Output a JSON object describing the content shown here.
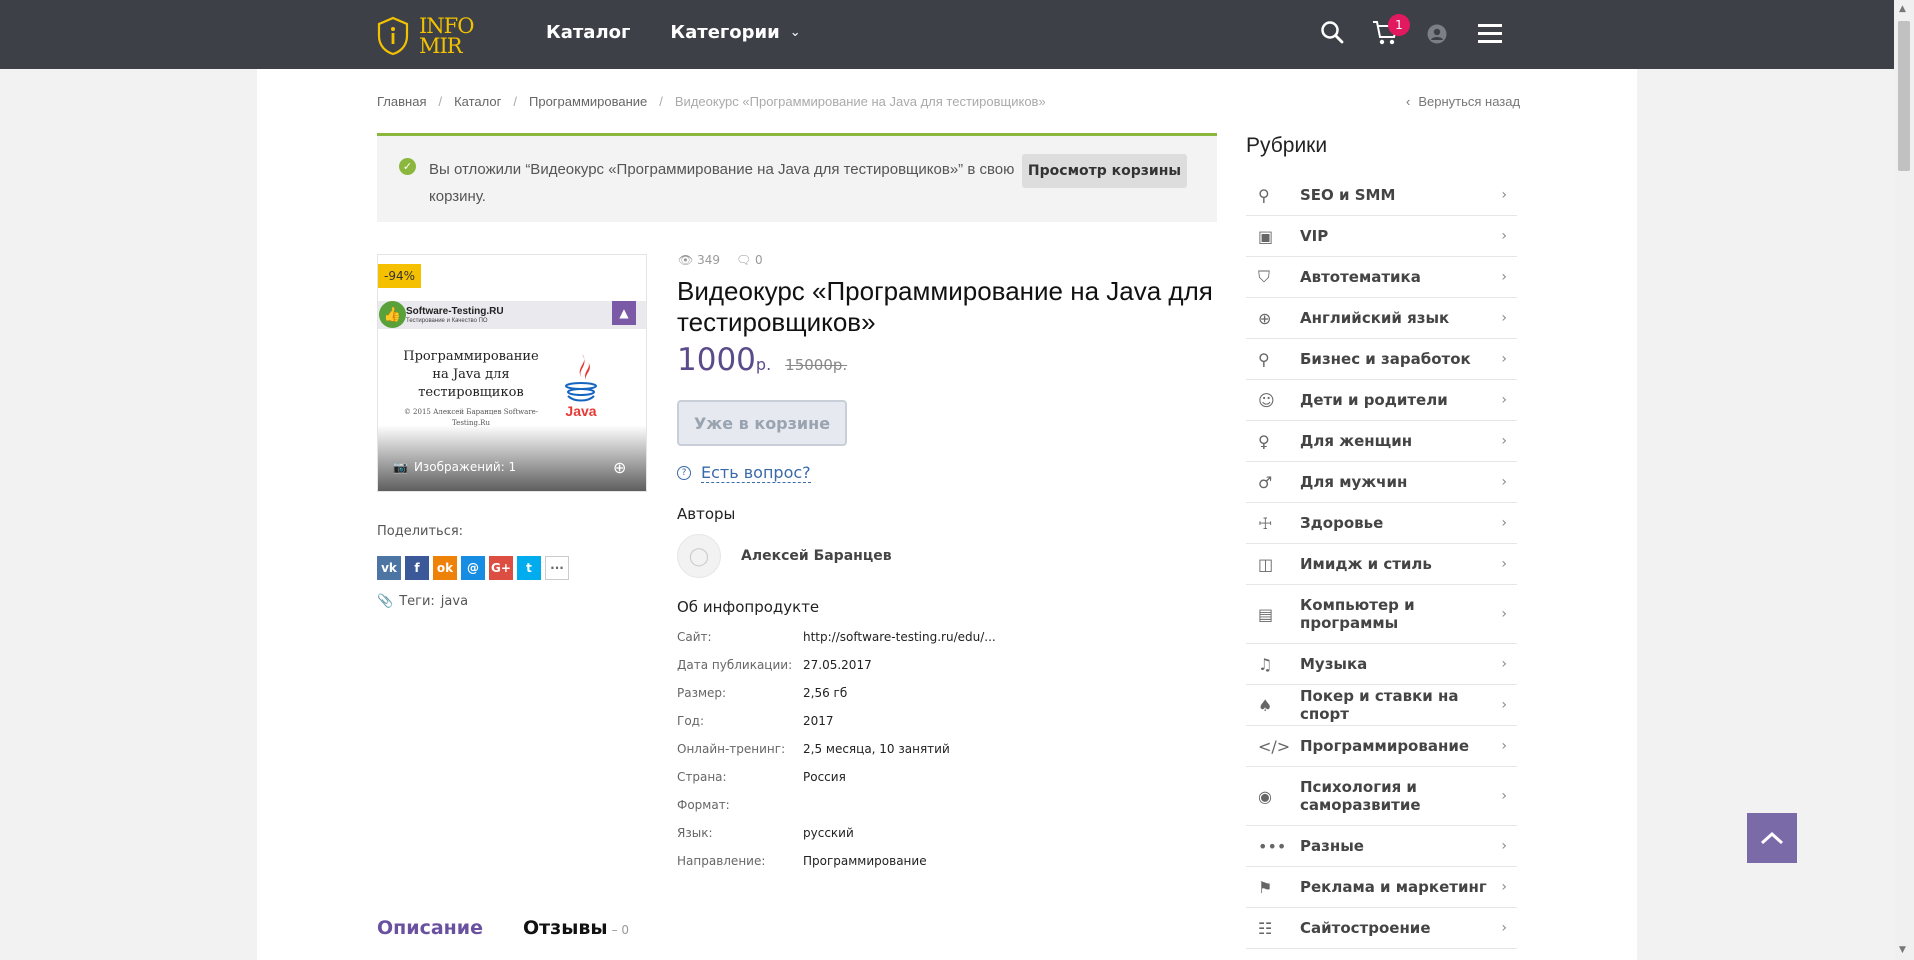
{
  "brand": {
    "line1": "INFO",
    "line2": "MIR"
  },
  "nav": {
    "catalog": "Каталог",
    "categories": "Категории"
  },
  "cart": {
    "count": "1"
  },
  "breadcrumb": {
    "items": [
      "Главная",
      "Каталог",
      "Программирование"
    ],
    "current": "Видеокурс «Программирование на Java для тестировщиков»",
    "back": "Вернуться назад"
  },
  "notice": {
    "message": "Вы отложили “Видеокурс «Программирование на Java для тестировщиков»” в свою корзину.",
    "button": "Просмотр корзины"
  },
  "image": {
    "sale_badge": "-94%",
    "header_title": "Software-Testing.RU",
    "header_sub": "Тестирование и Качество ПО",
    "title": "Программирование на Java для тестировщиков",
    "copyright": "© 2015 Алексей Баранцев Software-Testing.Ru",
    "java_label": "Java",
    "count_label": "Изображений: 1"
  },
  "share": {
    "label": "Поделиться:"
  },
  "tags": {
    "label": "Теги:",
    "value": "java"
  },
  "product": {
    "views": "349",
    "comments": "0",
    "title": "Видеокурс «Программирование на Java для тестировщиков»",
    "price": "1000",
    "currency": "р.",
    "old_price": "15000р.",
    "in_cart_button": "Уже в корзине",
    "ask": "Есть вопрос?",
    "authors_heading": "Авторы",
    "author": "Алексей Баранцев",
    "about_heading": "Об инфопродукте"
  },
  "properties": [
    {
      "key": "Сайт:",
      "value": "http://software-testing.ru/edu/..."
    },
    {
      "key": "Дата публикации:",
      "value": "27.05.2017"
    },
    {
      "key": "Размер:",
      "value": "2,56 гб"
    },
    {
      "key": "Год:",
      "value": "2017"
    },
    {
      "key": "Онлайн-тренинг:",
      "value": "2,5 месяца, 10 занятий"
    },
    {
      "key": "Страна:",
      "value": "Россия"
    },
    {
      "key": "Формат:",
      "value": ""
    },
    {
      "key": "Язык:",
      "value": "русский"
    },
    {
      "key": "Направление:",
      "value": "Программирование"
    }
  ],
  "tabs": {
    "description": "Описание",
    "reviews": "Отзывы",
    "reviews_count": "– 0"
  },
  "sidebar": {
    "heading": "Рубрики",
    "items": [
      {
        "label": "SEO и SMM",
        "icon": "magnifier-icon"
      },
      {
        "label": "VIP",
        "icon": "image-icon"
      },
      {
        "label": "Автотематика",
        "icon": "car-icon"
      },
      {
        "label": "Английский язык",
        "icon": "globe-icon"
      },
      {
        "label": "Бизнес и заработок",
        "icon": "people-icon"
      },
      {
        "label": "Дети и родители",
        "icon": "baby-icon"
      },
      {
        "label": "Для женщин",
        "icon": "female-icon"
      },
      {
        "label": "Для мужчин",
        "icon": "male-icon"
      },
      {
        "label": "Здоровье",
        "icon": "first-aid-icon"
      },
      {
        "label": "Имидж и стиль",
        "icon": "shirt-icon"
      },
      {
        "label": "Компьютер и программы",
        "icon": "monitor-icon"
      },
      {
        "label": "Музыка",
        "icon": "music-note-icon"
      },
      {
        "label": "Покер и ставки на спорт",
        "icon": "cards-icon"
      },
      {
        "label": "Программирование",
        "icon": "code-icon"
      },
      {
        "label": "Психология и саморазвитие",
        "icon": "head-icon"
      },
      {
        "label": "Разные",
        "icon": "dots-icon"
      },
      {
        "label": "Реклама и маркетинг",
        "icon": "megaphone-icon"
      },
      {
        "label": "Сайтостроение",
        "icon": "sitemap-icon"
      }
    ]
  },
  "colors": {
    "header": "#3d4047",
    "brand": "#f2c200",
    "accent": "#5b4b8a",
    "success": "#8bb83c",
    "badge": "#e2195f"
  }
}
